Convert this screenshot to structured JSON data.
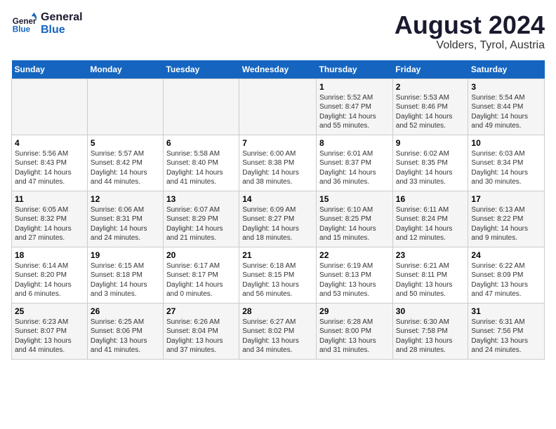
{
  "logo": {
    "line1": "General",
    "line2": "Blue"
  },
  "title": "August 2024",
  "location": "Volders, Tyrol, Austria",
  "days_of_week": [
    "Sunday",
    "Monday",
    "Tuesday",
    "Wednesday",
    "Thursday",
    "Friday",
    "Saturday"
  ],
  "weeks": [
    [
      {
        "day": "",
        "info": ""
      },
      {
        "day": "",
        "info": ""
      },
      {
        "day": "",
        "info": ""
      },
      {
        "day": "",
        "info": ""
      },
      {
        "day": "1",
        "info": "Sunrise: 5:52 AM\nSunset: 8:47 PM\nDaylight: 14 hours\nand 55 minutes."
      },
      {
        "day": "2",
        "info": "Sunrise: 5:53 AM\nSunset: 8:46 PM\nDaylight: 14 hours\nand 52 minutes."
      },
      {
        "day": "3",
        "info": "Sunrise: 5:54 AM\nSunset: 8:44 PM\nDaylight: 14 hours\nand 49 minutes."
      }
    ],
    [
      {
        "day": "4",
        "info": "Sunrise: 5:56 AM\nSunset: 8:43 PM\nDaylight: 14 hours\nand 47 minutes."
      },
      {
        "day": "5",
        "info": "Sunrise: 5:57 AM\nSunset: 8:42 PM\nDaylight: 14 hours\nand 44 minutes."
      },
      {
        "day": "6",
        "info": "Sunrise: 5:58 AM\nSunset: 8:40 PM\nDaylight: 14 hours\nand 41 minutes."
      },
      {
        "day": "7",
        "info": "Sunrise: 6:00 AM\nSunset: 8:38 PM\nDaylight: 14 hours\nand 38 minutes."
      },
      {
        "day": "8",
        "info": "Sunrise: 6:01 AM\nSunset: 8:37 PM\nDaylight: 14 hours\nand 36 minutes."
      },
      {
        "day": "9",
        "info": "Sunrise: 6:02 AM\nSunset: 8:35 PM\nDaylight: 14 hours\nand 33 minutes."
      },
      {
        "day": "10",
        "info": "Sunrise: 6:03 AM\nSunset: 8:34 PM\nDaylight: 14 hours\nand 30 minutes."
      }
    ],
    [
      {
        "day": "11",
        "info": "Sunrise: 6:05 AM\nSunset: 8:32 PM\nDaylight: 14 hours\nand 27 minutes."
      },
      {
        "day": "12",
        "info": "Sunrise: 6:06 AM\nSunset: 8:31 PM\nDaylight: 14 hours\nand 24 minutes."
      },
      {
        "day": "13",
        "info": "Sunrise: 6:07 AM\nSunset: 8:29 PM\nDaylight: 14 hours\nand 21 minutes."
      },
      {
        "day": "14",
        "info": "Sunrise: 6:09 AM\nSunset: 8:27 PM\nDaylight: 14 hours\nand 18 minutes."
      },
      {
        "day": "15",
        "info": "Sunrise: 6:10 AM\nSunset: 8:25 PM\nDaylight: 14 hours\nand 15 minutes."
      },
      {
        "day": "16",
        "info": "Sunrise: 6:11 AM\nSunset: 8:24 PM\nDaylight: 14 hours\nand 12 minutes."
      },
      {
        "day": "17",
        "info": "Sunrise: 6:13 AM\nSunset: 8:22 PM\nDaylight: 14 hours\nand 9 minutes."
      }
    ],
    [
      {
        "day": "18",
        "info": "Sunrise: 6:14 AM\nSunset: 8:20 PM\nDaylight: 14 hours\nand 6 minutes."
      },
      {
        "day": "19",
        "info": "Sunrise: 6:15 AM\nSunset: 8:18 PM\nDaylight: 14 hours\nand 3 minutes."
      },
      {
        "day": "20",
        "info": "Sunrise: 6:17 AM\nSunset: 8:17 PM\nDaylight: 14 hours\nand 0 minutes."
      },
      {
        "day": "21",
        "info": "Sunrise: 6:18 AM\nSunset: 8:15 PM\nDaylight: 13 hours\nand 56 minutes."
      },
      {
        "day": "22",
        "info": "Sunrise: 6:19 AM\nSunset: 8:13 PM\nDaylight: 13 hours\nand 53 minutes."
      },
      {
        "day": "23",
        "info": "Sunrise: 6:21 AM\nSunset: 8:11 PM\nDaylight: 13 hours\nand 50 minutes."
      },
      {
        "day": "24",
        "info": "Sunrise: 6:22 AM\nSunset: 8:09 PM\nDaylight: 13 hours\nand 47 minutes."
      }
    ],
    [
      {
        "day": "25",
        "info": "Sunrise: 6:23 AM\nSunset: 8:07 PM\nDaylight: 13 hours\nand 44 minutes."
      },
      {
        "day": "26",
        "info": "Sunrise: 6:25 AM\nSunset: 8:06 PM\nDaylight: 13 hours\nand 41 minutes."
      },
      {
        "day": "27",
        "info": "Sunrise: 6:26 AM\nSunset: 8:04 PM\nDaylight: 13 hours\nand 37 minutes."
      },
      {
        "day": "28",
        "info": "Sunrise: 6:27 AM\nSunset: 8:02 PM\nDaylight: 13 hours\nand 34 minutes."
      },
      {
        "day": "29",
        "info": "Sunrise: 6:28 AM\nSunset: 8:00 PM\nDaylight: 13 hours\nand 31 minutes."
      },
      {
        "day": "30",
        "info": "Sunrise: 6:30 AM\nSunset: 7:58 PM\nDaylight: 13 hours\nand 28 minutes."
      },
      {
        "day": "31",
        "info": "Sunrise: 6:31 AM\nSunset: 7:56 PM\nDaylight: 13 hours\nand 24 minutes."
      }
    ]
  ]
}
